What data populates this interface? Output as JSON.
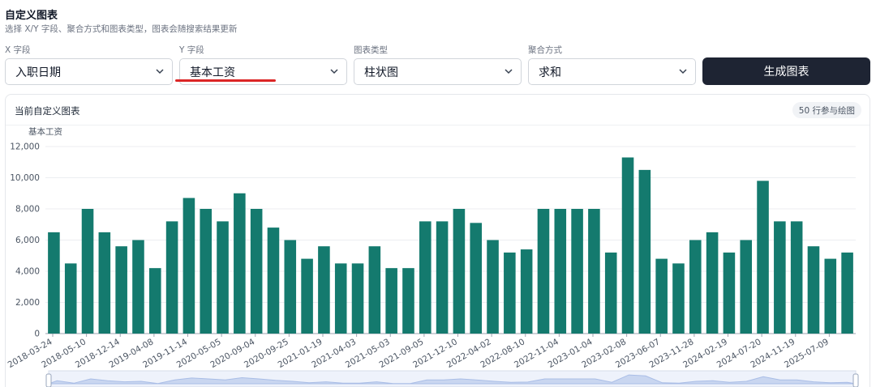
{
  "page": {
    "title": "自定义图表",
    "subtitle": "选择 X/Y 字段、聚合方式和图表类型，图表会随搜索结果更新"
  },
  "controls": {
    "x_field": {
      "label": "X 字段",
      "value": "入职日期"
    },
    "y_field": {
      "label": "Y 字段",
      "value": "基本工资"
    },
    "chart_type": {
      "label": "图表类型",
      "value": "柱状图"
    },
    "aggregation": {
      "label": "聚合方式",
      "value": "求和"
    },
    "generate_label": "生成图表"
  },
  "card": {
    "title": "当前自定义图表",
    "rows_badge": "50 行参与绘图"
  },
  "colors": {
    "bar": "#147a6e",
    "button": "#1e2433",
    "highlight_underline": "#dc2626"
  },
  "chart_data": {
    "type": "bar",
    "ylabel": "基本工资",
    "ylim": [
      0,
      12000
    ],
    "yticks": [
      0,
      2000,
      4000,
      6000,
      8000,
      10000,
      12000
    ],
    "ytick_labels": [
      "0",
      "2,000",
      "4,000",
      "6,000",
      "8,000",
      "10,000",
      "12,000"
    ],
    "grid": true,
    "xtick_labels": [
      "2018-03-24",
      "2018-05-10",
      "2018-12-14",
      "2019-04-08",
      "2019-11-14",
      "2020-05-05",
      "2020-09-04",
      "2020-09-25",
      "2021-01-19",
      "2021-04-03",
      "2021-05-03",
      "2021-09-05",
      "2021-12-10",
      "2022-04-02",
      "2022-08-10",
      "2022-11-04",
      "2023-01-04",
      "2023-02-08",
      "2023-06-07",
      "2023-11-28",
      "2024-02-19",
      "2024-07-20",
      "2024-11-19",
      "2025-07-09"
    ],
    "values": [
      6500,
      4500,
      8000,
      6500,
      5600,
      6000,
      4200,
      7200,
      8700,
      8000,
      7200,
      9000,
      8000,
      6800,
      6000,
      4800,
      5600,
      4500,
      4500,
      5600,
      4200,
      4200,
      7200,
      7200,
      8000,
      7100,
      6000,
      5200,
      5400,
      8000,
      8000,
      8000,
      8000,
      5200,
      11300,
      10500,
      4800,
      4500,
      6000,
      6500,
      5200,
      6000,
      9800,
      7200,
      7200,
      5600,
      4800,
      5200
    ]
  }
}
